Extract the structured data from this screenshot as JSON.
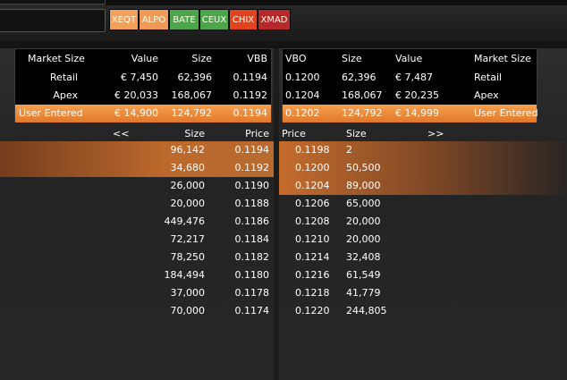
{
  "venues": [
    {
      "label": "XEQT",
      "color": "#f4a05a"
    },
    {
      "label": "ALPO",
      "color": "#f19a55"
    },
    {
      "label": "BATE",
      "color": "#4aa648"
    },
    {
      "label": "CEUX",
      "color": "#4aa648"
    },
    {
      "label": "CHIX",
      "color": "#e2431f"
    },
    {
      "label": "XMAD",
      "color": "#b8282a"
    }
  ],
  "bid_summary": {
    "headers": {
      "market_size": "Market Size",
      "value": "Value",
      "size": "Size",
      "vbb": "VBB"
    },
    "rows": [
      {
        "market_size": "Retail",
        "value": "€ 7,450",
        "size": "62,396",
        "vbb": "0.1194"
      },
      {
        "market_size": "Apex",
        "value": "€ 20,033",
        "size": "168,067",
        "vbb": "0.1192"
      },
      {
        "market_size": "User Entered",
        "value": "€ 14,900",
        "size": "124,792",
        "vbb": "0.1194"
      }
    ]
  },
  "ask_summary": {
    "headers": {
      "vbo": "VBO",
      "size": "Size",
      "value": "Value",
      "market_size": "Market Size"
    },
    "rows": [
      {
        "vbo": "0.1200",
        "size": "62,396",
        "value": "€ 7,487",
        "market_size": "Retail"
      },
      {
        "vbo": "0.1204",
        "size": "168,067",
        "value": "€ 20,235",
        "market_size": "Apex"
      },
      {
        "vbo": "0.1202",
        "size": "124,792",
        "value": "€ 14,999",
        "market_size": "User Entered"
      }
    ]
  },
  "bid_book": {
    "nav": "<<",
    "headers": {
      "size": "Size",
      "price": "Price"
    },
    "levels": [
      {
        "size": "96,142",
        "price": "0.1194"
      },
      {
        "size": "34,680",
        "price": "0.1192"
      },
      {
        "size": "26,000",
        "price": "0.1190"
      },
      {
        "size": "20,000",
        "price": "0.1188"
      },
      {
        "size": "449,476",
        "price": "0.1186"
      },
      {
        "size": "72,217",
        "price": "0.1184"
      },
      {
        "size": "78,250",
        "price": "0.1182"
      },
      {
        "size": "184,494",
        "price": "0.1180"
      },
      {
        "size": "37,000",
        "price": "0.1178"
      },
      {
        "size": "70,000",
        "price": "0.1174"
      }
    ]
  },
  "ask_book": {
    "nav": ">>",
    "headers": {
      "price": "Price",
      "size": "Size"
    },
    "levels": [
      {
        "price": "0.1198",
        "size": "2"
      },
      {
        "price": "0.1200",
        "size": "50,500"
      },
      {
        "price": "0.1204",
        "size": "89,000"
      },
      {
        "price": "0.1206",
        "size": "65,000"
      },
      {
        "price": "0.1208",
        "size": "20,000"
      },
      {
        "price": "0.1210",
        "size": "20,000"
      },
      {
        "price": "0.1214",
        "size": "32,408"
      },
      {
        "price": "0.1216",
        "size": "61,549"
      },
      {
        "price": "0.1218",
        "size": "41,779"
      },
      {
        "price": "0.1220",
        "size": "244,805"
      }
    ]
  },
  "colors": {
    "highlight": "#e0782a",
    "user_row": "#f39a4a",
    "background": "#1c1c1c"
  }
}
